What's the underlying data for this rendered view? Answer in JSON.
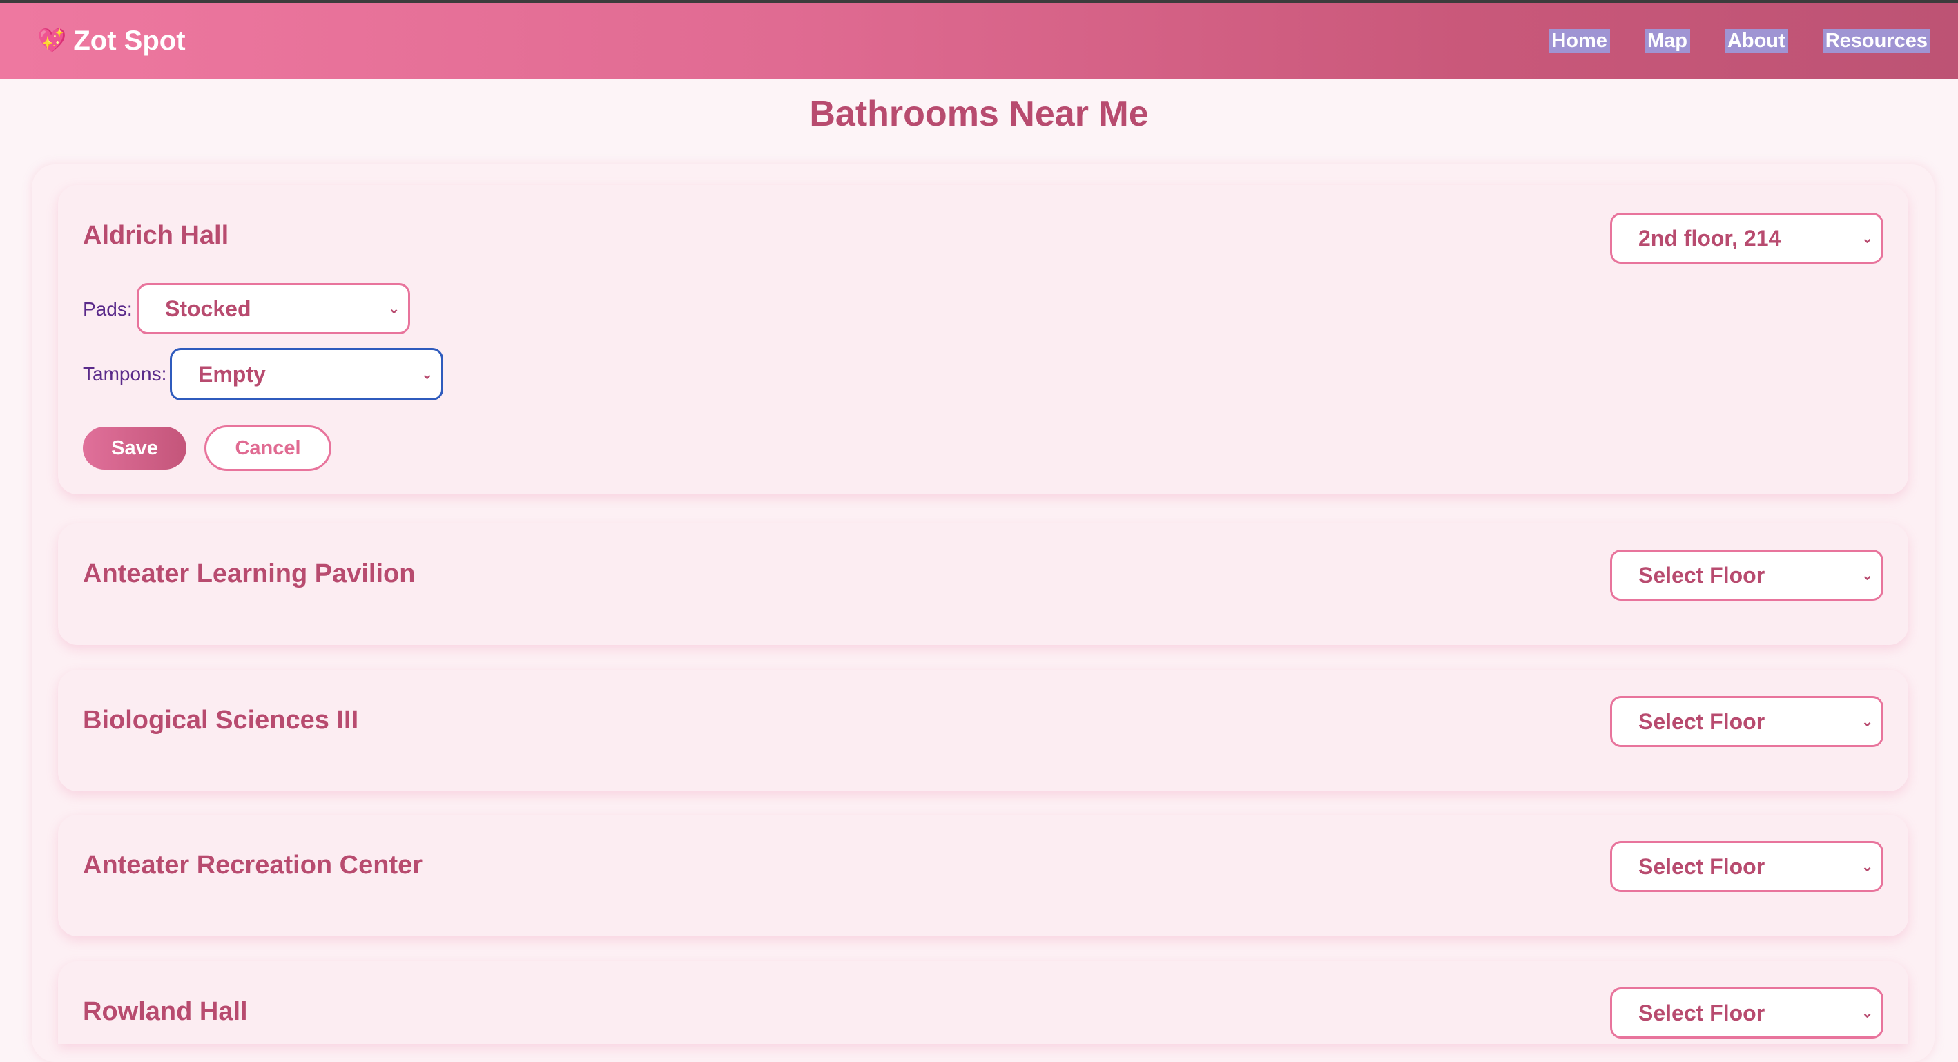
{
  "nav": {
    "brand_icon": "💖",
    "brand": "Zot Spot",
    "links": [
      "Home",
      "Map",
      "About",
      "Resources"
    ]
  },
  "page": {
    "title": "Bathrooms Near Me"
  },
  "buildings": [
    {
      "name": "Aldrich Hall",
      "floor": "2nd floor, 214",
      "pads_label": "Pads:",
      "pads_value": "Stocked",
      "tampons_label": "Tampons:",
      "tampons_value": "Empty",
      "save_label": "Save",
      "cancel_label": "Cancel"
    },
    {
      "name": "Anteater Learning Pavilion",
      "floor": "Select Floor"
    },
    {
      "name": "Biological Sciences III",
      "floor": "Select Floor"
    },
    {
      "name": "Anteater Recreation Center",
      "floor": "Select Floor"
    },
    {
      "name": "Rowland Hall",
      "floor": "Select Floor"
    }
  ],
  "icons": {
    "dropdown": "chevron-down-icon",
    "brand": "sparkling-heart-icon"
  },
  "colors": {
    "accent": "#b84b6f",
    "nav_start": "#ee78a0",
    "nav_end": "#bd5374",
    "border": "#e8749c",
    "focus": "#2f5bbd"
  }
}
